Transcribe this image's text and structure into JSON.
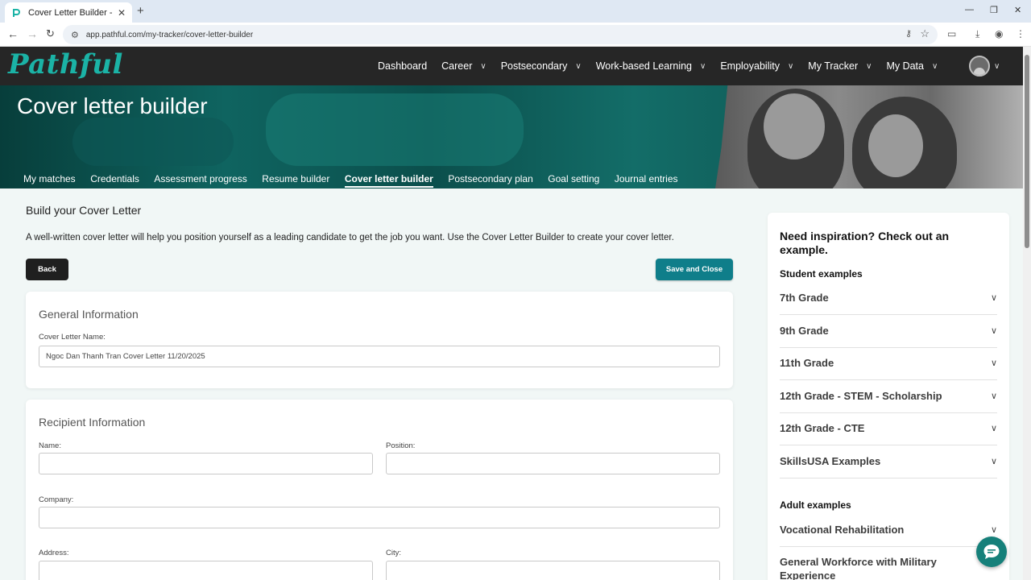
{
  "browser": {
    "tab_title": "Cover Letter Builder - Pathful",
    "url": "app.pathful.com/my-tracker/cover-letter-builder"
  },
  "brand": {
    "logo_text": "Pathful",
    "accent": "#1bb3a6"
  },
  "nav": {
    "items": [
      {
        "label": "Dashboard",
        "has_menu": false
      },
      {
        "label": "Career",
        "has_menu": true
      },
      {
        "label": "Postsecondary",
        "has_menu": true
      },
      {
        "label": "Work-based Learning",
        "has_menu": true
      },
      {
        "label": "Employability",
        "has_menu": true
      },
      {
        "label": "My Tracker",
        "has_menu": true
      },
      {
        "label": "My Data",
        "has_menu": true
      }
    ]
  },
  "hero": {
    "title": "Cover letter builder"
  },
  "subnav": {
    "items": [
      "My matches",
      "Credentials",
      "Assessment progress",
      "Resume builder",
      "Cover letter builder",
      "Postsecondary plan",
      "Goal setting",
      "Journal entries"
    ],
    "active_index": 4
  },
  "page": {
    "heading": "Build your Cover Letter",
    "intro": "A well-written cover letter will help you position yourself as a leading candidate to get the job you want. Use the Cover Letter Builder to create your cover letter.",
    "back_label": "Back",
    "save_label": "Save and Close"
  },
  "general": {
    "heading": "General Information",
    "name_label": "Cover Letter Name:",
    "name_value": "Ngoc Dan Thanh Tran Cover Letter 11/20/2025"
  },
  "recipient": {
    "heading": "Recipient Information",
    "name_label": "Name:",
    "position_label": "Position:",
    "company_label": "Company:",
    "address_label": "Address:",
    "city_label": "City:"
  },
  "sidebar": {
    "heading": "Need inspiration? Check out an example.",
    "student_heading": "Student examples",
    "student_items": [
      "7th Grade",
      "9th Grade",
      "11th Grade",
      "12th Grade - STEM - Scholarship",
      "12th Grade - CTE",
      "SkillsUSA Examples"
    ],
    "adult_heading": "Adult examples",
    "adult_items": [
      "Vocational Rehabilitation",
      "General Workforce with Military Experience"
    ]
  },
  "colors": {
    "header_bg": "#262626",
    "primary_button": "#0f7e8a",
    "dark_button": "#1f1f1f"
  }
}
